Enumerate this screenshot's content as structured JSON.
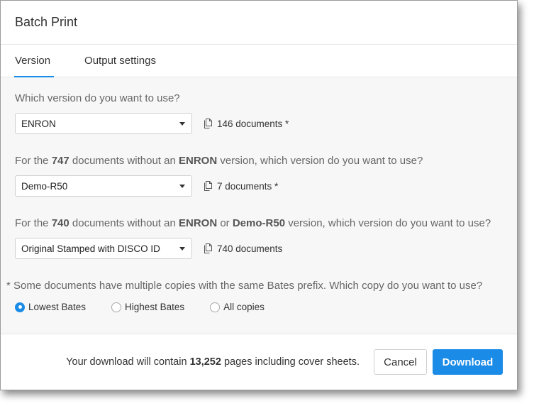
{
  "dialog": {
    "title": "Batch Print"
  },
  "tabs": [
    {
      "label": "Version",
      "active": true
    },
    {
      "label": "Output settings",
      "active": false
    }
  ],
  "questions": [
    {
      "text_parts": [
        "Which version do you want to use?"
      ],
      "selected": "ENRON",
      "count_label": "146 documents *"
    },
    {
      "text_parts": [
        "For the ",
        "747",
        " documents without an ",
        "ENRON",
        " version, which version do you want to use?"
      ],
      "selected": "Demo-R50",
      "count_label": "7 documents *"
    },
    {
      "text_parts": [
        "For the ",
        "740",
        " documents without an ",
        "ENRON",
        " or ",
        "Demo-R50",
        " version, which version do you want to use?"
      ],
      "selected": "Original Stamped with DISCO ID",
      "count_label": "740 documents"
    }
  ],
  "copies": {
    "note": "* Some documents have multiple copies with the same Bates prefix. Which copy do you want to use?",
    "options": [
      {
        "label": "Lowest Bates",
        "checked": true
      },
      {
        "label": "Highest Bates",
        "checked": false
      },
      {
        "label": "All copies",
        "checked": false
      }
    ]
  },
  "footer": {
    "summary_prefix": "Your download will contain ",
    "summary_pages": "13,252",
    "summary_suffix": " pages including cover sheets.",
    "cancel_label": "Cancel",
    "download_label": "Download"
  },
  "colors": {
    "accent": "#1a8be6"
  },
  "icons": {
    "select_caret": "caret-down-icon",
    "count": "documents-icon"
  }
}
